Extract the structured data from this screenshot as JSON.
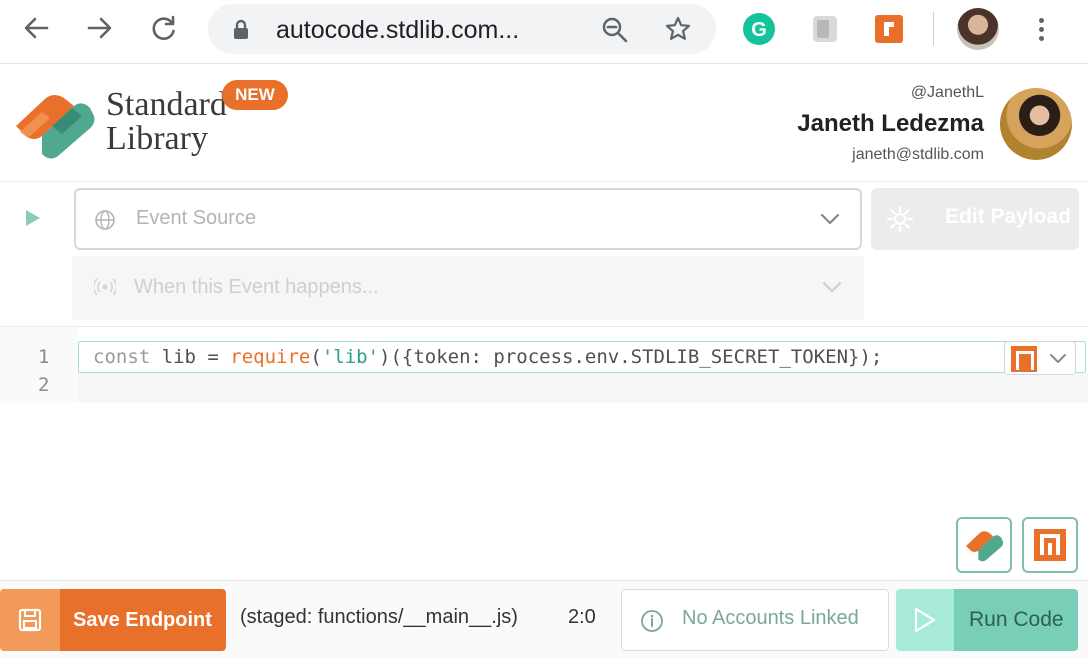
{
  "browser": {
    "url": "autocode.stdlib.com...",
    "icons": [
      "back-arrow-icon",
      "forward-arrow-icon",
      "reload-icon",
      "lock-icon",
      "zoom-icon",
      "bookmark-star-icon",
      "grammarly-extension-icon",
      "notion-extension-icon",
      "stdlib-extension-icon",
      "profile-avatar",
      "more-menu-icon"
    ]
  },
  "header": {
    "brand_line1": "Standard",
    "brand_line2": "Library",
    "new_badge": "NEW",
    "user_handle": "@JanethL",
    "user_name": "Janeth Ledezma",
    "user_email": "janeth@stdlib.com"
  },
  "event": {
    "source_placeholder": "Event Source",
    "when_placeholder": "When this Event happens...",
    "edit_payload_label": "Edit Payload"
  },
  "editor": {
    "line_numbers": [
      "1",
      "2"
    ],
    "line1": {
      "kw": "const",
      "var": " lib = ",
      "fn": "require",
      "p1": "(",
      "str": "'lib'",
      "rest": ")({token: process.env.STDLIB_SECRET_TOKEN});"
    }
  },
  "footer": {
    "save_label": "Save Endpoint",
    "staged_text": "(staged: functions/__main__.js)",
    "cursor_pos": "2:0",
    "accounts_label": "No Accounts Linked",
    "run_label": "Run Code"
  },
  "colors": {
    "accent_orange": "#e9702b",
    "accent_teal": "#79ceb7",
    "string_teal": "#2f9b8f"
  }
}
